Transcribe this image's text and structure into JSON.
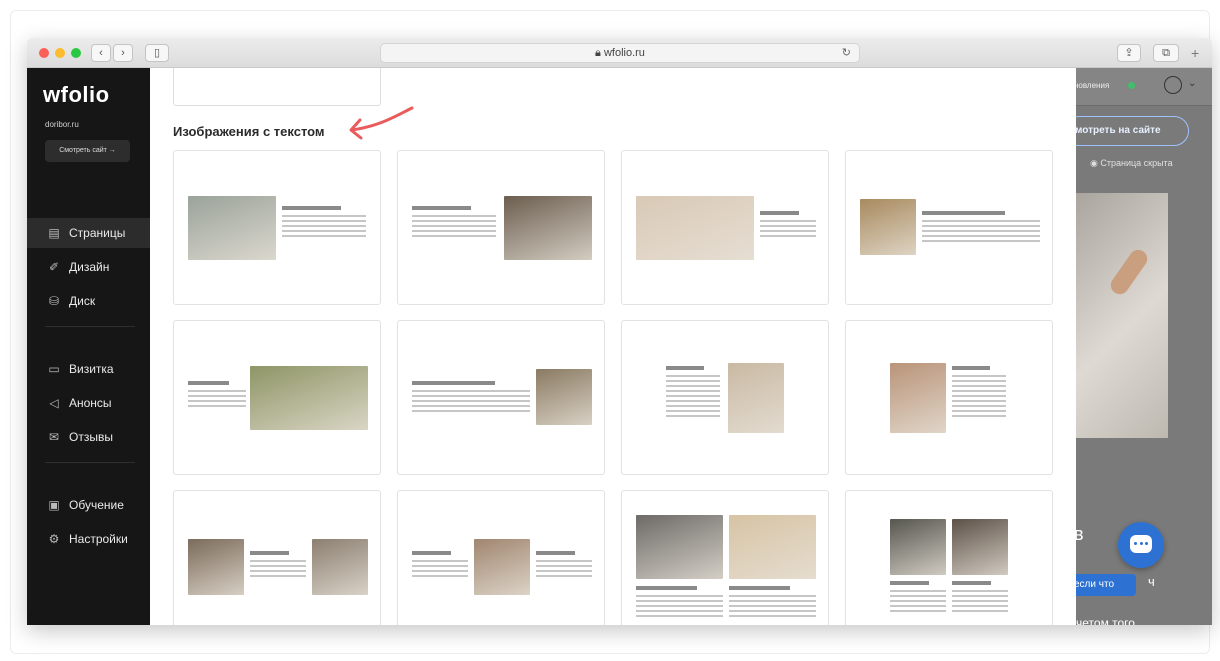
{
  "browser": {
    "url": "wfolio.ru"
  },
  "sidebar": {
    "logo": "wfolio",
    "domain": "doribor.ru",
    "view_site": "Смотреть сайт →",
    "groups": [
      [
        {
          "label": "Страницы",
          "icon": "document-icon",
          "glyph": "▤",
          "active": true
        },
        {
          "label": "Дизайн",
          "icon": "brush-icon",
          "glyph": "✐"
        },
        {
          "label": "Диск",
          "icon": "disk-icon",
          "glyph": "⛁"
        }
      ],
      [
        {
          "label": "Визитка",
          "icon": "card-icon",
          "glyph": "▭"
        },
        {
          "label": "Анонсы",
          "icon": "megaphone-icon",
          "glyph": "◁"
        },
        {
          "label": "Отзывы",
          "icon": "reviews-icon",
          "glyph": "✉"
        }
      ],
      [
        {
          "label": "Обучение",
          "icon": "book-icon",
          "glyph": "▣"
        },
        {
          "label": "Настройки",
          "icon": "gear-icon",
          "glyph": "⚙"
        }
      ]
    ]
  },
  "main": {
    "section_title": "Изображения с текстом",
    "cards": [
      [
        {
          "layout": "img-left",
          "tones": [
            "#9aa39a"
          ]
        },
        {
          "layout": "img-right",
          "tones": [
            "#6b5e4f"
          ]
        },
        {
          "layout": "img-left-small",
          "tones": [
            "#d9c9b6"
          ]
        },
        {
          "layout": "img-left-sq",
          "tones": [
            "#a88a5e"
          ]
        }
      ],
      [
        {
          "layout": "img-right-wide",
          "tones": [
            "#8e9565"
          ]
        },
        {
          "layout": "img-right-sq",
          "tones": [
            "#8a7a62"
          ]
        },
        {
          "layout": "img-right-tall",
          "tones": [
            "#c9b9a3"
          ]
        },
        {
          "layout": "img-left-tall",
          "tones": [
            "#b99479"
          ]
        }
      ],
      [
        {
          "layout": "two-img",
          "tones": [
            "#7b6b5a",
            "#8b7f70"
          ]
        },
        {
          "layout": "center-img",
          "tones": [
            "#a08670"
          ]
        },
        {
          "layout": "two-top",
          "tones": [
            "#6d6a67",
            "#d7c3a4"
          ]
        },
        {
          "layout": "two-top-small",
          "tones": [
            "#56554f",
            "#5d5148"
          ]
        }
      ]
    ]
  },
  "preview": {
    "top_text": "новления",
    "button": "мотреть на сайте",
    "hidden": "Страница скрыта",
    "letter": "в",
    "pill": "если что",
    "pill_tail": "ч",
    "bottom_text": "четом того,"
  },
  "colors": {
    "sidebar_bg": "#161616",
    "accent": "#2d72d2",
    "arrow": "#ea5b5b"
  }
}
